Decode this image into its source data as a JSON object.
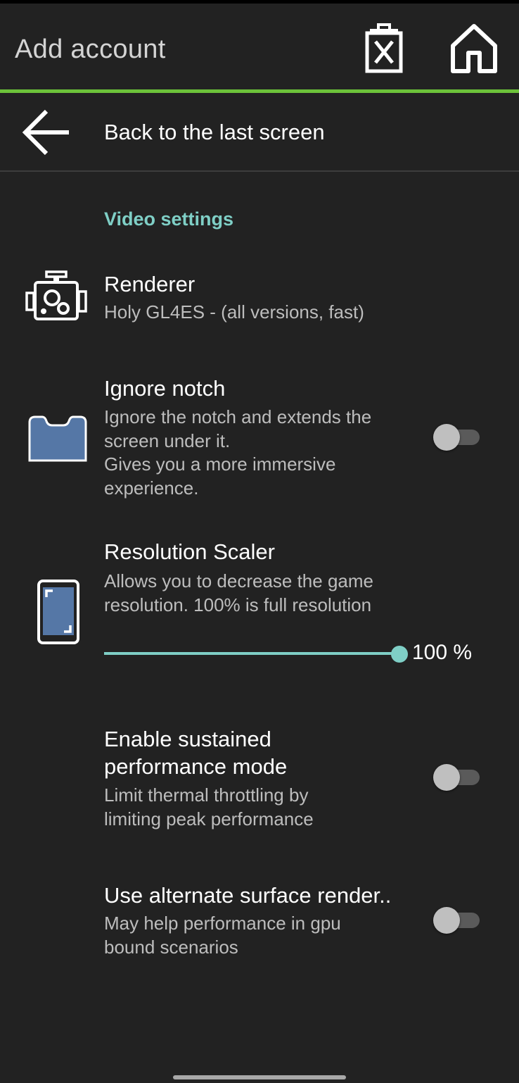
{
  "topbar": {
    "title": "Add account",
    "delete_icon": "delete-x-icon",
    "home_icon": "home-icon"
  },
  "back": {
    "label": "Back to the last screen",
    "icon": "arrow-left-icon"
  },
  "section": {
    "title": "Video settings"
  },
  "prefs": [
    {
      "title": "Renderer",
      "summary": "Holy GL4ES - (all versions, fast)",
      "icon": "engine-icon"
    },
    {
      "title": "Ignore notch",
      "summary_lines": [
        "Ignore the notch and extends the",
        "screen under it.",
        "Gives you a more immersive",
        "experience."
      ],
      "icon": "notch-icon",
      "switch": "off"
    },
    {
      "title": "Resolution Scaler",
      "summary_lines": [
        "Allows you to decrease the game",
        "resolution. 100% is full resolution"
      ],
      "icon": "resolution-phone-icon",
      "slider_value": 100,
      "slider_label": "100 %"
    },
    {
      "title_lines": [
        "Enable sustained",
        "performance mode"
      ],
      "summary_lines": [
        "Limit thermal throttling by",
        "limiting peak performance"
      ],
      "switch": "off"
    },
    {
      "title": "Use alternate surface render..",
      "summary_lines": [
        "May help performance in gpu",
        "bound scenarios"
      ],
      "switch": "off"
    }
  ],
  "colors": {
    "background": "#222222",
    "accent_green": "#6cc23a",
    "accent_teal": "#7fcfc6",
    "summary_text": "#bdbdbd"
  }
}
